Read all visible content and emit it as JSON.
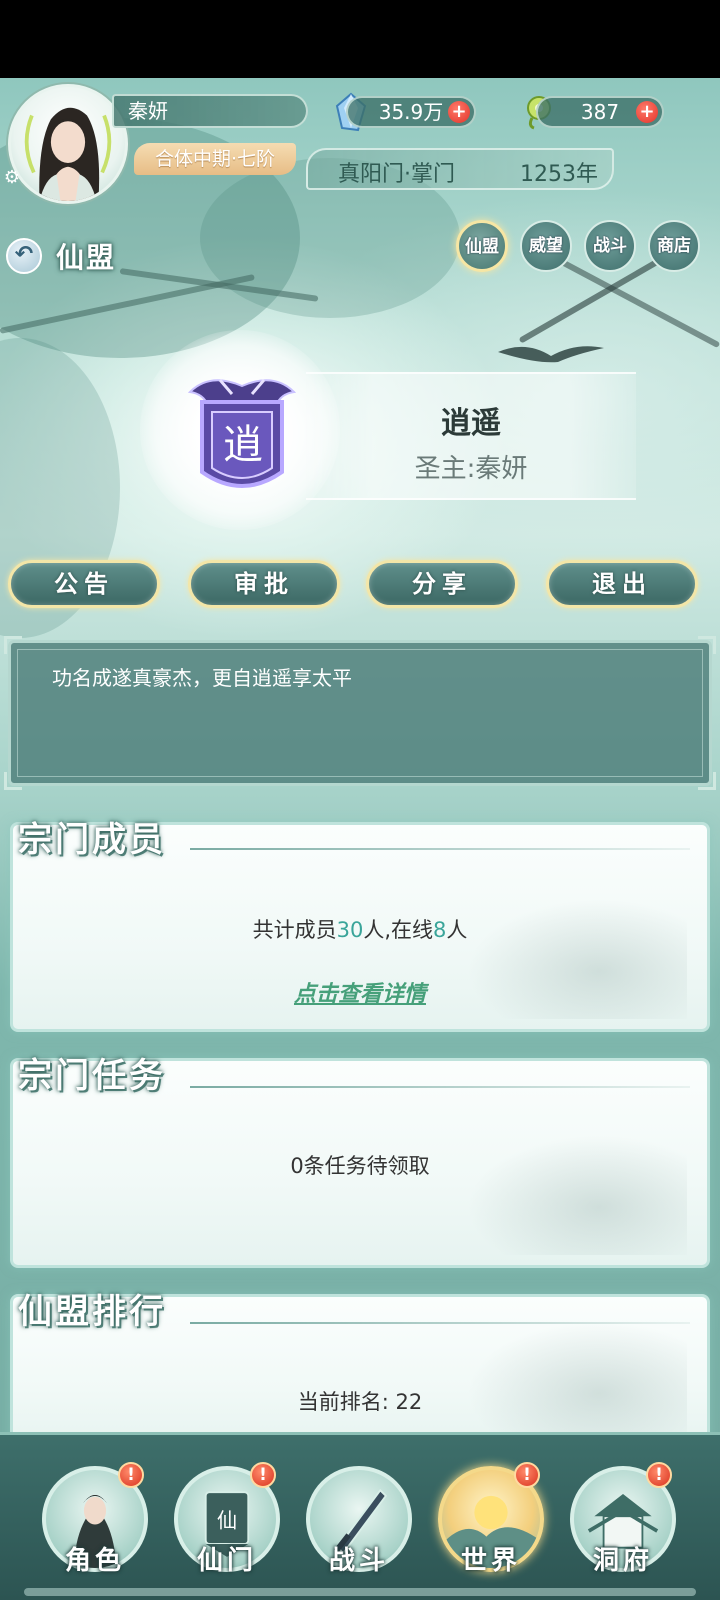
{
  "player": {
    "name": "秦妍",
    "rank": "合体中期·七阶"
  },
  "resources": {
    "gems": "35.9万",
    "jade": "387",
    "plus": "+"
  },
  "sect": {
    "name": "真阳门·掌门",
    "years": "1253年"
  },
  "page": {
    "back_icon": "back-arrow-icon",
    "title": "仙盟"
  },
  "tabs": [
    {
      "label": "仙盟",
      "active": true
    },
    {
      "label": "威望",
      "active": false
    },
    {
      "label": "战斗",
      "active": false
    },
    {
      "label": "商店",
      "active": false
    }
  ],
  "alliance": {
    "emblem_char": "逍",
    "name": "逍遥",
    "leader": "圣主:秦妍"
  },
  "actions": [
    "公告",
    "审批",
    "分享",
    "退出"
  ],
  "notice": {
    "text": "功名成遂真豪杰，更自逍遥享太平"
  },
  "members": {
    "title": "宗门成员",
    "summary_prefix": "共计成员",
    "total": "30",
    "summary_mid": "人,在线",
    "online": "8",
    "summary_suffix": "人",
    "detail_link": "点击查看详情"
  },
  "tasks": {
    "title": "宗门任务",
    "summary": "0条任务待领取"
  },
  "ranking": {
    "title": "仙盟排行",
    "summary": "当前排名:  22"
  },
  "bottom_nav": [
    {
      "label": "角色",
      "icon": "character-icon",
      "badge": "!"
    },
    {
      "label": "仙门",
      "icon": "sect-banner-icon",
      "badge": "!"
    },
    {
      "label": "战斗",
      "icon": "sword-icon",
      "badge": ""
    },
    {
      "label": "世界",
      "icon": "world-sunrise-icon",
      "badge": "!",
      "active": true
    },
    {
      "label": "洞府",
      "icon": "cave-pavilion-icon",
      "badge": "!"
    }
  ],
  "colors": {
    "accent_gold": "#f3e6a8",
    "teal_dark": "#3c6864",
    "highlight": "#3aa59a",
    "badge_red": "#d9321f"
  }
}
